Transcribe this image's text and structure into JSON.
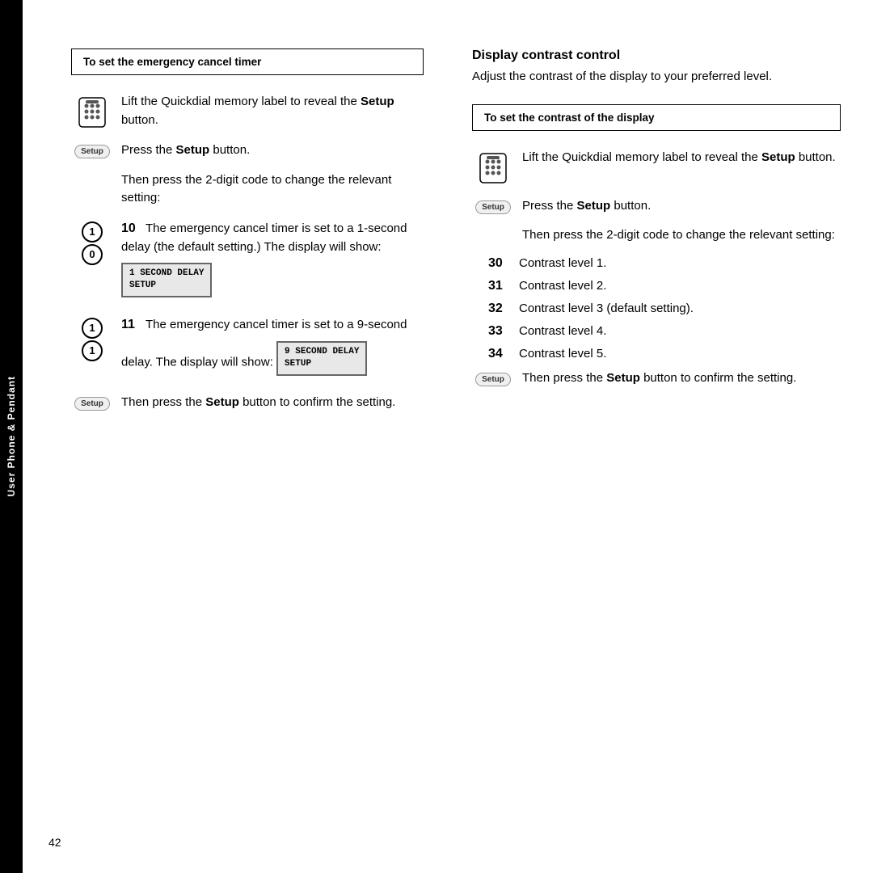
{
  "sidebar": {
    "label": "User Phone & Pendant"
  },
  "page_number": "42",
  "left_section": {
    "box_title": "To set the emergency cancel timer",
    "steps": [
      {
        "type": "phone-setup",
        "text_parts": [
          "Lift the Quickdial memory label to reveal the ",
          "Setup",
          " button."
        ]
      },
      {
        "type": "setup-only",
        "text_parts": [
          "Press the ",
          "Setup",
          " button."
        ]
      },
      {
        "type": "text-only",
        "text": "Then press the 2-digit code to change the relevant setting:"
      },
      {
        "type": "num-circles",
        "digits": [
          "1",
          "0"
        ],
        "number": "10",
        "text_parts": [
          "The emergency cancel timer is set to a 1-second delay (the default setting.) The display will show:"
        ],
        "display_line1": "1 SECOND DELAY",
        "display_line2": "SETUP"
      },
      {
        "type": "num-circles",
        "digits": [
          "1",
          "1"
        ],
        "number": "11",
        "text_parts": [
          "The emergency cancel timer is set to a 9-second delay. The display will show:"
        ],
        "display_line1": "9 SECOND DELAY",
        "display_line2": "SETUP"
      },
      {
        "type": "setup-confirm",
        "text_parts": [
          "Then press the ",
          "Setup",
          " button to confirm the setting."
        ]
      }
    ]
  },
  "right_section": {
    "section_title": "Display contrast control",
    "intro_text": "Adjust the contrast of the display to your preferred level.",
    "box_title": "To set the contrast of the display",
    "steps": [
      {
        "type": "phone-setup",
        "text_parts": [
          "Lift the Quickdial memory label to reveal the ",
          "Setup",
          " button."
        ]
      },
      {
        "type": "setup-only",
        "text_parts": [
          "Press the ",
          "Setup",
          " button."
        ]
      },
      {
        "type": "text-only",
        "text": "Then press the 2-digit code to change the relevant setting:"
      },
      {
        "type": "num-list",
        "items": [
          {
            "num": "30",
            "desc": "Contrast level 1."
          },
          {
            "num": "31",
            "desc": "Contrast level 2."
          },
          {
            "num": "32",
            "desc": "Contrast level 3 (default setting)."
          },
          {
            "num": "33",
            "desc": "Contrast level 4."
          },
          {
            "num": "34",
            "desc": "Contrast level 5."
          }
        ]
      },
      {
        "type": "setup-confirm",
        "text_parts": [
          "Then press the ",
          "Setup",
          " button to confirm the setting."
        ]
      }
    ]
  }
}
